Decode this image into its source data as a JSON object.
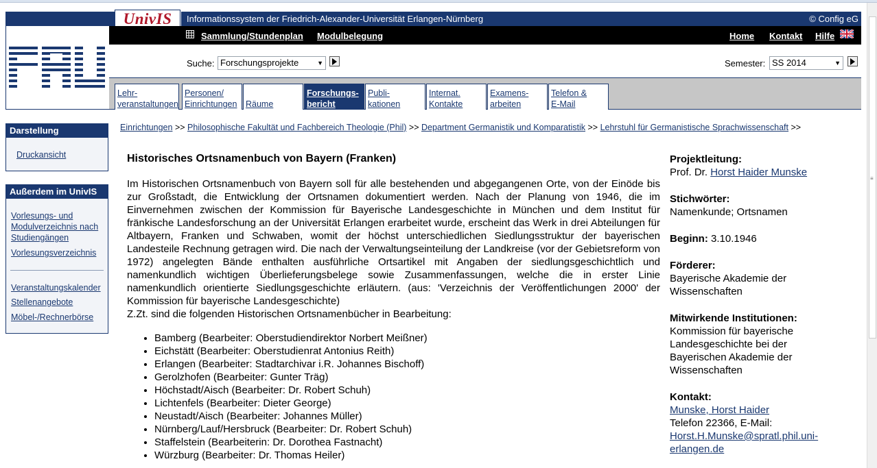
{
  "header": {
    "logo": "UnivIS",
    "info": "Informationssystem der Friedrich-Alexander-Universität Erlangen-Nürnberg",
    "copyright": "© Config eG",
    "nav_left": [
      "Sammlung/Stundenplan",
      "Modulbelegung"
    ],
    "nav_right": [
      "Home",
      "Kontakt",
      "Hilfe"
    ],
    "search_label": "Suche:",
    "search_value": "Forschungsprojekte",
    "semester_label": "Semester:",
    "semester_value": "SS 2014",
    "tabs": [
      {
        "line1": "Lehr-",
        "line2": "veranstaltungen"
      },
      {
        "line1": "Personen/",
        "line2": "Einrichtungen"
      },
      {
        "line1": "",
        "line2": "Räume"
      },
      {
        "line1": "Forschungs-",
        "line2": "bericht"
      },
      {
        "line1": "Publi-",
        "line2": "kationen"
      },
      {
        "line1": "Internat.",
        "line2": "Kontakte"
      },
      {
        "line1": "Examens-",
        "line2": "arbeiten"
      },
      {
        "line1": "Telefon &",
        "line2": "E-Mail"
      }
    ]
  },
  "sidebar": {
    "box1_title": "Darstellung",
    "box1_link": "Druckansicht",
    "box2_title": "Außerdem im UnivIS",
    "box2_link1_l1": "Vorlesungs- und",
    "box2_link1_l2": "Modulverzeichnis nach",
    "box2_link1_l3": "Studiengängen",
    "box2_link2": "Vorlesungsverzeichnis",
    "box2_link3": "Veranstaltungskalender",
    "box2_link4": "Stellenangebote",
    "box2_link5": "Möbel-/Rechnerbörse"
  },
  "breadcrumb": {
    "items": [
      "Einrichtungen",
      "Philosophische Fakultät und Fachbereich Theologie (Phil)",
      "Department Germanistik und Komparatistik",
      "Lehrstuhl für Germanistische Sprachwissenschaft"
    ],
    "sep": ">>"
  },
  "project": {
    "title": "Historisches Ortsnamenbuch von Bayern (Franken)",
    "description": "Im Historischen Ortsnamenbuch von Bayern soll für alle bestehenden und abgegangenen Orte, von der Einöde bis zur Großstadt, die Entwicklung der Ortsnamen dokumentiert werden. Nach der Planung von 1946, die im Einvernehmen zwischen der Kommission für Bayerische Landesgeschichte in München und dem Institut für fränkische Landesforschung an der Universität Erlangen erarbeitet wurde, erscheint das Werk in drei Abteilungen für Altbayern, Franken und Schwaben, womit der höchst unterschiedlichen Siedlungsstruktur der bayerischen Landesteile Rechnung getragen wird. Die nach der Verwaltungseinteilung der Landkreise (vor der Gebietsreform von 1972) angelegten Bände enthalten ausführliche Ortsartikel mit Angaben der siedlungsgeschichtlich und namenkundlich wichtigen Überlieferungsbelege sowie Zusammenfassungen, welche die in erster Linie namenkundlich orientierte Siedlungsgeschichte erläutern. (aus: 'Verzeichnis der Veröffentlichungen 2000' der Kommission für bayerische Landesgeschichte)",
    "intro_list": "Z.Zt. sind die folgenden Historischen Ortsnamenbücher in Bearbeitung:",
    "list": [
      "Bamberg (Bearbeiter: Oberstudiendirektor Norbert Meißner)",
      "Eichstätt (Bearbeiter: Oberstudienrat Antonius Reith)",
      "Erlangen (Bearbeiter: Stadtarchivar i.R. Johannes Bischoff)",
      "Gerolzhofen (Bearbeiter: Gunter Träg)",
      "Höchstadt/Aisch (Bearbeiter: Dr. Robert Schuh)",
      "Lichtenfels (Bearbeiter: Dieter George)",
      "Neustadt/Aisch (Bearbeiter: Johannes Müller)",
      "Nürnberg/Lauf/Hersbruck (Bearbeiter: Dr. Robert Schuh)",
      "Staffelstein (Bearbeiterin: Dr. Dorothea Fastnacht)",
      "Würzburg (Bearbeiter: Dr. Thomas Heiler)"
    ]
  },
  "meta": {
    "lead_label": "Projektleitung:",
    "lead_prefix": "Prof. Dr.",
    "lead_name": "Horst Haider Munske",
    "keywords_label": "Stichwörter:",
    "keywords": "Namenkunde; Ortsnamen",
    "begin_label": "Beginn:",
    "begin": "3.10.1946",
    "sponsor_label": "Förderer:",
    "sponsor_l1": "Bayerische Akademie der",
    "sponsor_l2": "Wissenschaften",
    "inst_label": "Mitwirkende Institutionen:",
    "inst_l1": "Kommission für bayerische",
    "inst_l2": "Landesgeschichte bei der",
    "inst_l3": "Bayerischen Akademie der",
    "inst_l4": "Wissenschaften",
    "contact_label": "Kontakt:",
    "contact_name": "Munske, Horst Haider",
    "contact_phone": "Telefon 22366, E-Mail:",
    "contact_mail_l1": "Horst.H.Munske@spratl.phil.uni-",
    "contact_mail_l2": "erlangen.de"
  }
}
